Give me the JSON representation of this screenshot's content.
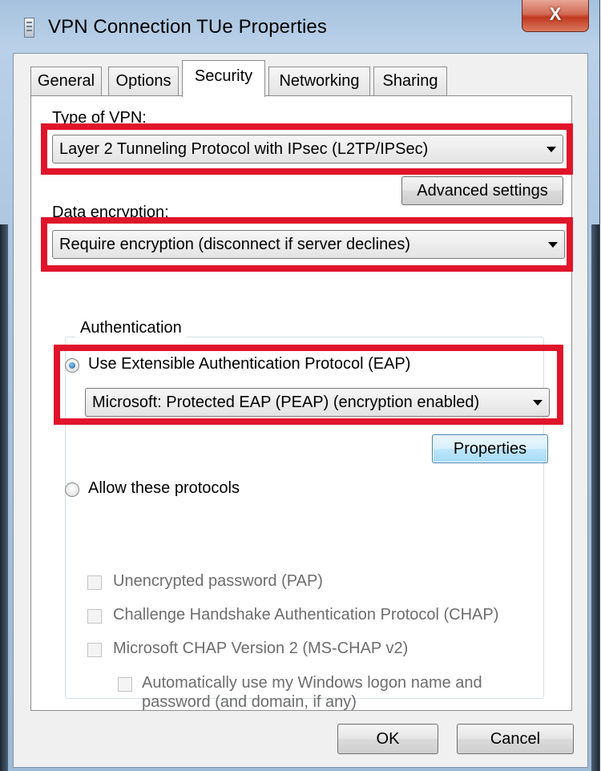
{
  "window": {
    "title": "VPN Connection TUe Properties",
    "close_glyph": "X"
  },
  "tabs": [
    {
      "label": "General",
      "active": false
    },
    {
      "label": "Options",
      "active": false
    },
    {
      "label": "Security",
      "active": true
    },
    {
      "label": "Networking",
      "active": false
    },
    {
      "label": "Sharing",
      "active": false
    }
  ],
  "security": {
    "vpn_type_label": "Type of VPN:",
    "vpn_type_value": "Layer 2 Tunneling Protocol with IPsec (L2TP/IPSec)",
    "advanced_settings_label": "Advanced settings",
    "data_encryption_label": "Data encryption:",
    "data_encryption_value": "Require encryption (disconnect if server declines)",
    "authentication": {
      "group_title": "Authentication",
      "eap_option_label": "Use Extensible Authentication Protocol (EAP)",
      "eap_option_checked": true,
      "eap_method_value": "Microsoft: Protected EAP (PEAP) (encryption enabled)",
      "properties_label": "Properties",
      "allow_protocols_label": "Allow these protocols",
      "allow_protocols_checked": false,
      "protocols": [
        {
          "label": "Unencrypted password (PAP)",
          "checked": false,
          "enabled": false
        },
        {
          "label": "Challenge Handshake Authentication Protocol (CHAP)",
          "checked": false,
          "enabled": false
        },
        {
          "label": "Microsoft CHAP Version 2 (MS-CHAP v2)",
          "checked": false,
          "enabled": false
        }
      ],
      "auto_logon_line1": "Automatically use my Windows logon name and",
      "auto_logon_line2": "password (and domain, if any)",
      "auto_logon_checked": false
    }
  },
  "footer": {
    "ok_label": "OK",
    "cancel_label": "Cancel"
  },
  "annotation_color": "#e0142a"
}
